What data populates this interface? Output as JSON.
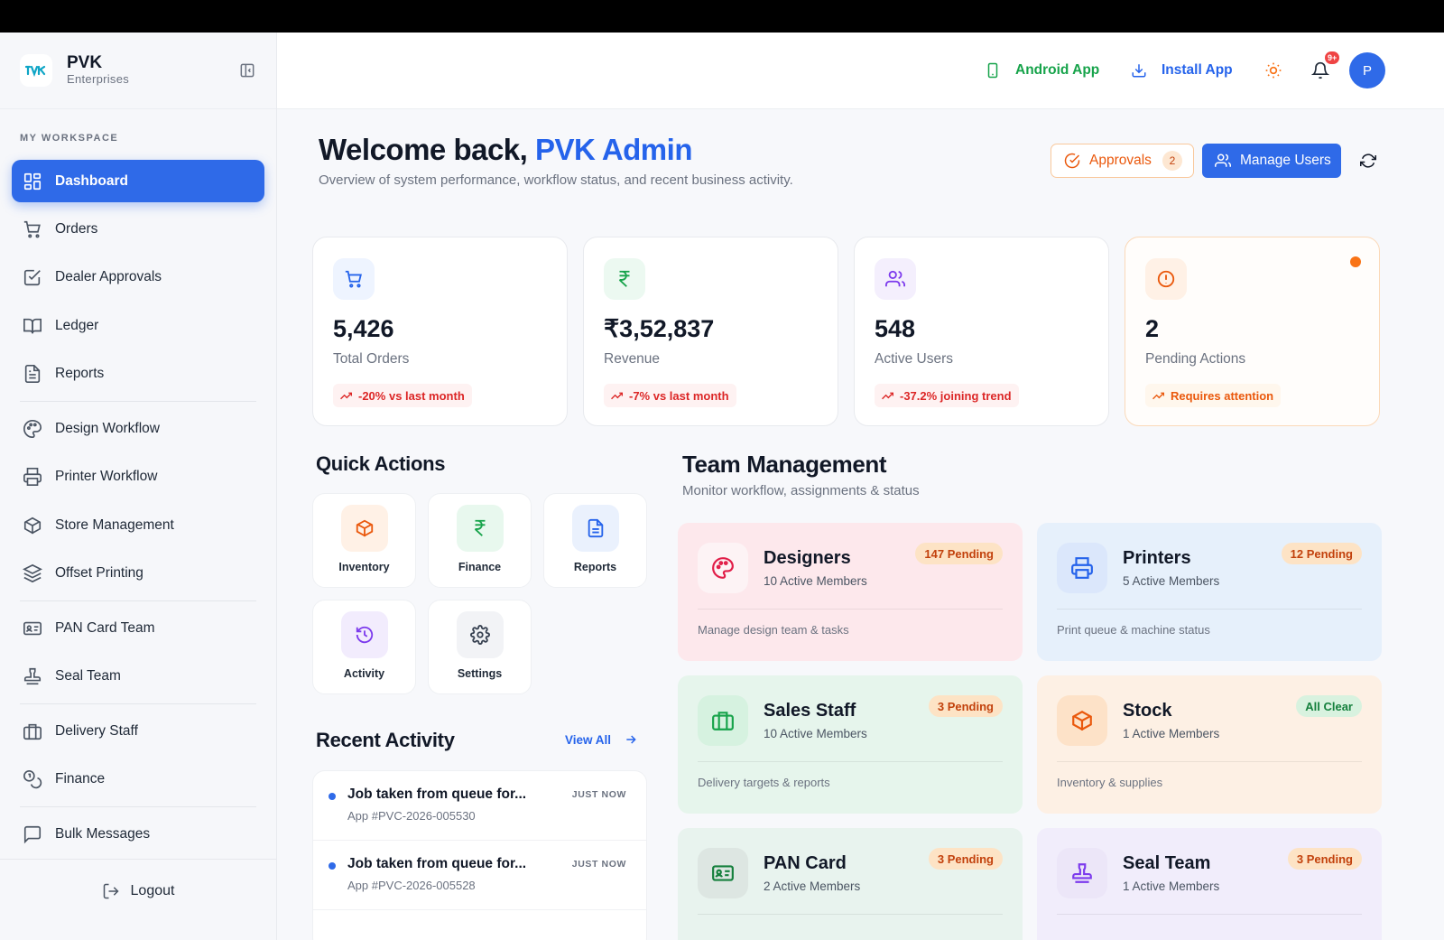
{
  "brand": {
    "logo_text": "PVK",
    "name": "PVK",
    "sub": "Enterprises"
  },
  "sidebar": {
    "section_label": "MY WORKSPACE",
    "items": [
      {
        "label": "Dashboard",
        "icon": "grid-icon"
      },
      {
        "label": "Orders",
        "icon": "cart-icon"
      },
      {
        "label": "Dealer Approvals",
        "icon": "check-square-icon"
      },
      {
        "label": "Ledger",
        "icon": "book-icon"
      },
      {
        "label": "Reports",
        "icon": "file-text-icon"
      },
      {
        "label": "Design Workflow",
        "icon": "palette-icon"
      },
      {
        "label": "Printer Workflow",
        "icon": "printer-icon"
      },
      {
        "label": "Store Management",
        "icon": "box-icon"
      },
      {
        "label": "Offset Printing",
        "icon": "layers-icon"
      },
      {
        "label": "PAN Card Team",
        "icon": "id-card-icon"
      },
      {
        "label": "Seal Team",
        "icon": "stamp-icon"
      },
      {
        "label": "Delivery Staff",
        "icon": "briefcase-icon"
      },
      {
        "label": "Finance",
        "icon": "coins-icon"
      },
      {
        "label": "Bulk Messages",
        "icon": "message-icon"
      }
    ],
    "logout_label": "Logout"
  },
  "header": {
    "android_label": "Android App",
    "install_label": "Install App",
    "notification_count": "9+",
    "avatar_initial": "P"
  },
  "welcome": {
    "prefix": "Welcome back, ",
    "name": "PVK Admin",
    "subtitle": "Overview of system performance, workflow status, and recent business activity."
  },
  "actions": {
    "approvals_label": "Approvals",
    "approvals_count": "2",
    "manage_users_label": "Manage Users"
  },
  "stats": [
    {
      "value": "5,426",
      "label": "Total Orders",
      "trend": "-20% vs last month",
      "icon": "cart-icon",
      "color": "#3b82f6"
    },
    {
      "value": "₹3,52,837",
      "label": "Revenue",
      "trend": "-7% vs last month",
      "icon": "rupee-icon",
      "color": "#16a34a"
    },
    {
      "value": "548",
      "label": "Active Users",
      "trend": "-37.2% joining trend",
      "icon": "users-icon",
      "color": "#7c3aed"
    },
    {
      "value": "2",
      "label": "Pending Actions",
      "trend": "Requires attention",
      "icon": "alert-icon",
      "color": "#ea580c"
    }
  ],
  "quick_actions": {
    "title": "Quick Actions",
    "items": [
      {
        "label": "Inventory",
        "icon": "box-icon"
      },
      {
        "label": "Finance",
        "icon": "rupee-icon"
      },
      {
        "label": "Reports",
        "icon": "file-text-icon"
      },
      {
        "label": "Activity",
        "icon": "history-icon"
      },
      {
        "label": "Settings",
        "icon": "gear-icon"
      }
    ]
  },
  "recent_activity": {
    "title": "Recent Activity",
    "view_all": "View All",
    "items": [
      {
        "title": "Job taken from queue for...",
        "sub": "App #PVC-2026-005530",
        "time": "JUST NOW"
      },
      {
        "title": "Job taken from queue for...",
        "sub": "App #PVC-2026-005528",
        "time": "JUST NOW"
      }
    ]
  },
  "team": {
    "title": "Team Management",
    "subtitle": "Monitor workflow, assignments & status",
    "cards": [
      {
        "name": "Designers",
        "members": "10 Active Members",
        "badge": "147 Pending",
        "desc": "Manage design team & tasks",
        "icon": "palette-icon",
        "bg": "#fde8ec",
        "accent": "#e11d48"
      },
      {
        "name": "Printers",
        "members": "5 Active Members",
        "badge": "12 Pending",
        "desc": "Print queue & machine status",
        "icon": "printer-icon",
        "bg": "#e6f0fb",
        "accent": "#2563eb"
      },
      {
        "name": "Sales Staff",
        "members": "10 Active Members",
        "badge": "3 Pending",
        "desc": "Delivery targets & reports",
        "icon": "briefcase-icon",
        "bg": "#e6f5ec",
        "accent": "#16a34a"
      },
      {
        "name": "Stock",
        "members": "1 Active Members",
        "badge": "All Clear",
        "desc": "Inventory & supplies",
        "icon": "box-icon",
        "bg": "#fdf0e4",
        "accent": "#ea580c"
      },
      {
        "name": "PAN Card",
        "members": "2 Active Members",
        "badge": "3 Pending",
        "desc": "",
        "icon": "id-card-icon",
        "bg": "#e8f3ee",
        "accent": "#15803d"
      },
      {
        "name": "Seal Team",
        "members": "1 Active Members",
        "badge": "3 Pending",
        "desc": "",
        "icon": "stamp-icon",
        "bg": "#f1edfb",
        "accent": "#7c3aed"
      }
    ]
  }
}
